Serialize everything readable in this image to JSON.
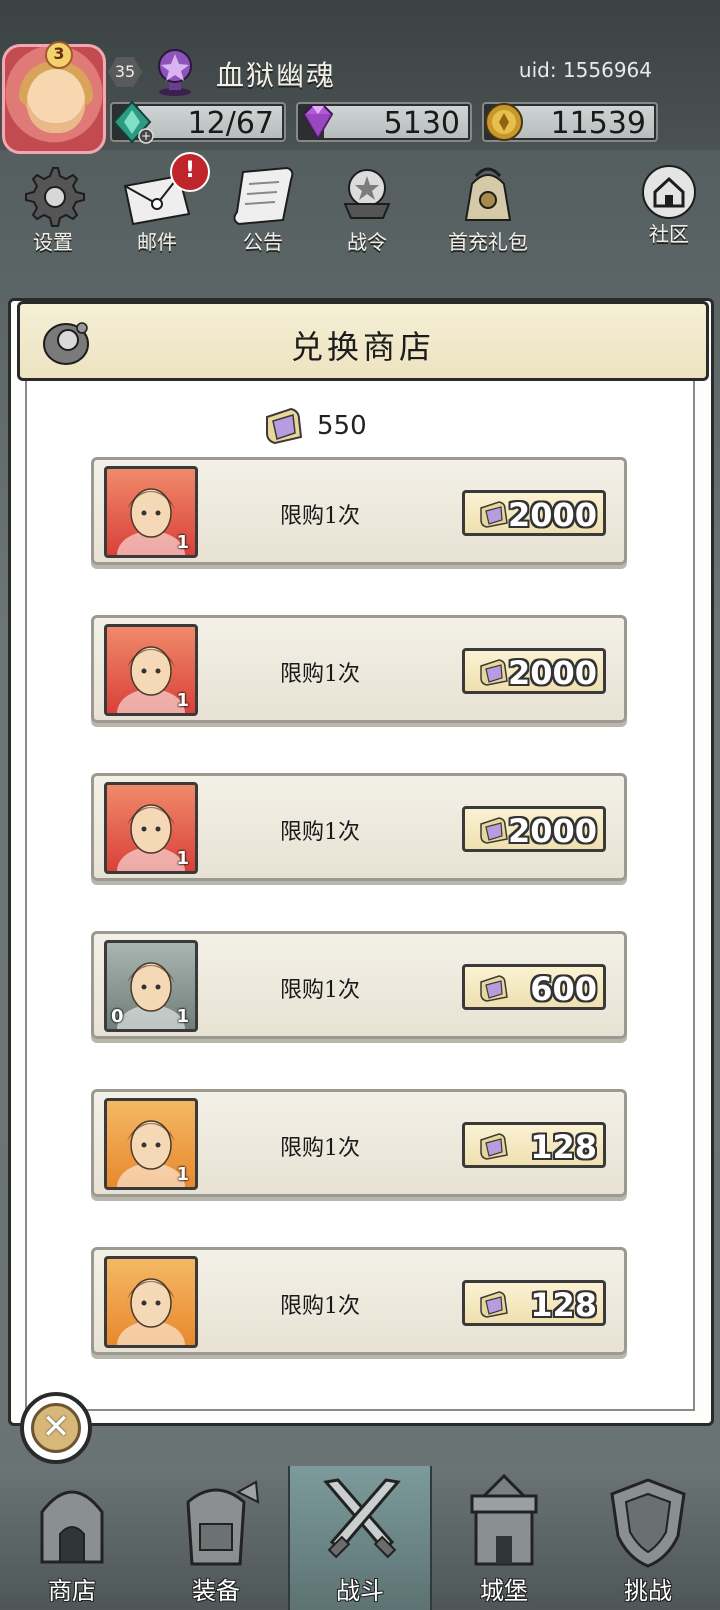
{
  "header": {
    "level": "35",
    "vip_level": "3",
    "player_name": "血狱幽魂",
    "uid": "uid: 1556964",
    "resources": [
      {
        "name": "stamina",
        "value": "12/67",
        "icon": "green-crystal-icon"
      },
      {
        "name": "gems",
        "value": "5130",
        "icon": "purple-diamond-icon"
      },
      {
        "name": "gold",
        "value": "11539",
        "icon": "gold-coin-icon"
      }
    ],
    "mail_badge": "!"
  },
  "menu": [
    {
      "label": "设置",
      "icon": "gear-icon"
    },
    {
      "label": "邮件",
      "icon": "mail-icon"
    },
    {
      "label": "公告",
      "icon": "scroll-icon"
    },
    {
      "label": "战令",
      "icon": "battle-pass-icon"
    },
    {
      "label": "首充礼包",
      "icon": "gift-bag-icon"
    },
    {
      "label": "社区",
      "icon": "home-icon"
    }
  ],
  "dialog": {
    "title": "兑换商店",
    "balance": "550",
    "items": [
      {
        "limit": "限购1次",
        "price": "2000",
        "count": "1",
        "count_left": "",
        "portrait": "hero-white-beard",
        "colors": [
          "#d9413a",
          "#f08a6a"
        ]
      },
      {
        "limit": "限购1次",
        "price": "2000",
        "count": "1",
        "count_left": "",
        "portrait": "hero-blonde",
        "colors": [
          "#d9413a",
          "#f08a6a"
        ]
      },
      {
        "limit": "限购1次",
        "price": "2000",
        "count": "1",
        "count_left": "",
        "portrait": "hero-pink-hair",
        "colors": [
          "#d9413a",
          "#f08a6a"
        ]
      },
      {
        "limit": "限购1次",
        "price": "600",
        "count": "1",
        "count_left": "0",
        "portrait": "hero-dark-haired",
        "colors": [
          "#6f7f7b",
          "#a9b5b1"
        ]
      },
      {
        "limit": "限购1次",
        "price": "128",
        "count": "1",
        "count_left": "",
        "portrait": "hero-crowned",
        "colors": [
          "#e8892d",
          "#f5b865"
        ]
      },
      {
        "limit": "限购1次",
        "price": "128",
        "count": "",
        "count_left": "",
        "portrait": "hero-witch",
        "colors": [
          "#e8892d",
          "#f5b865"
        ]
      }
    ]
  },
  "bottom_nav": [
    {
      "label": "商店",
      "icon": "shop-icon",
      "active": false
    },
    {
      "label": "装备",
      "icon": "backpack-icon",
      "active": false
    },
    {
      "label": "战斗",
      "icon": "crossed-swords-icon",
      "active": true
    },
    {
      "label": "城堡",
      "icon": "castle-icon",
      "active": false
    },
    {
      "label": "挑战",
      "icon": "shield-icon",
      "active": false
    }
  ]
}
